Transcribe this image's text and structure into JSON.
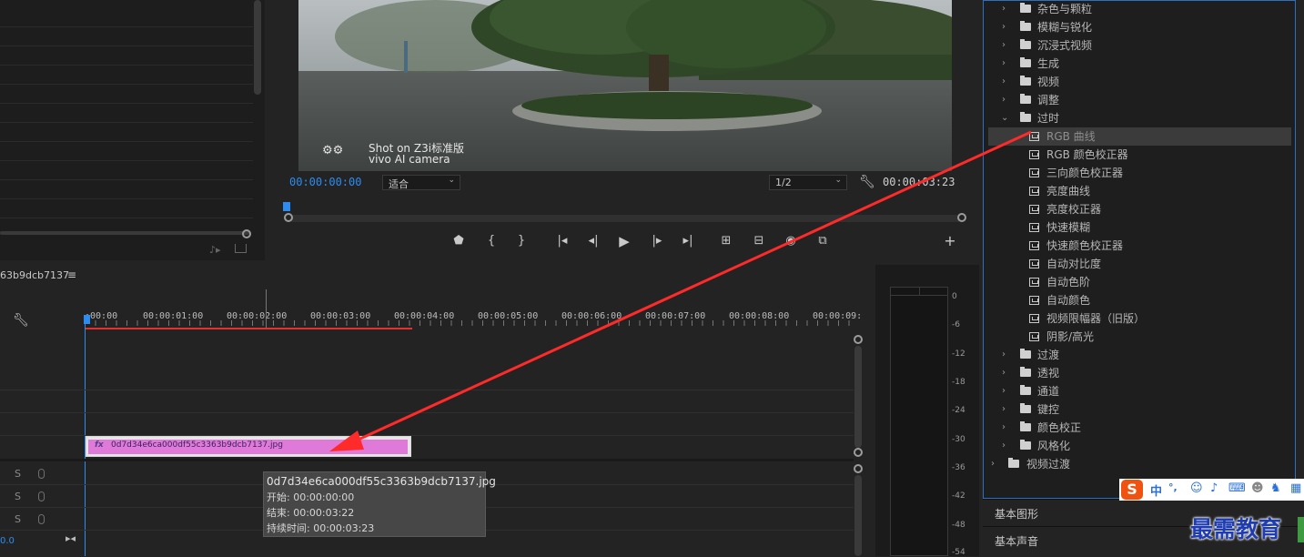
{
  "monitor": {
    "timecode_current": "00:00:00:00",
    "fit_label": "适合",
    "resolution_label": "1/2",
    "timecode_duration": "00:00:03:23",
    "watermark_line1": "Shot on Z3i标准版",
    "watermark_line2": "vivo AI camera"
  },
  "timeline": {
    "sequence_name": "63b9dcb7137",
    "menu_icon": "hamburger-icon",
    "ruler_labels": [
      ":00:00",
      "00:00:01:00",
      "00:00:02:00",
      "00:00:03:00",
      "00:00:04:00",
      "00:00:05:00",
      "00:00:06:00",
      "00:00:07:00",
      "00:00:08:00",
      "00:00:09:"
    ],
    "clip_name": "0d7d34e6ca000df55c3363b9dcb7137.jpg",
    "clip_fx_badge": "fx",
    "track_toggle": "S",
    "bottom_value": "0.0",
    "clip_color": "#e07ad8",
    "playhead_color": "#2d8cf0"
  },
  "tooltip": {
    "name": "0d7d34e6ca000df55c3363b9dcb7137.jpg",
    "start": "开始: 00:00:00:00",
    "end": "结束: 00:00:03:22",
    "duration": "持续时间: 00:00:03:23"
  },
  "meter": {
    "db_labels": [
      "0",
      "-6",
      "-12",
      "-18",
      "-24",
      "-30",
      "-36",
      "-42",
      "-48",
      "-54"
    ]
  },
  "effects": {
    "top_folders": [
      "杂色与颗粒",
      "模糊与锐化",
      "沉浸式视频",
      "生成",
      "视频",
      "调整"
    ],
    "open_folder": "过时",
    "open_items": [
      "RGB 曲线",
      "RGB 颜色校正器",
      "三向颜色校正器",
      "亮度曲线",
      "亮度校正器",
      "快速模糊",
      "快速颜色校正器",
      "自动对比度",
      "自动色阶",
      "自动颜色",
      "视频限幅器（旧版）",
      "阴影/高光"
    ],
    "selected_item": "RGB 曲线",
    "after_folders": [
      "过渡",
      "透视",
      "通道",
      "键控",
      "颜色校正",
      "风格化"
    ],
    "root_folder": "视频过渡"
  },
  "panels": {
    "essential_graphics": "基本图形",
    "essential_sound": "基本声音"
  },
  "ime": {
    "logo": "S",
    "lang": "中",
    "punct": "°,",
    "icons": [
      "smiley-icon",
      "microphone-icon",
      "keyboard-icon",
      "user-icon",
      "shirt-icon",
      "grid-icon"
    ]
  },
  "brand_watermark": "最需教育",
  "annotation": {
    "arrow_color": "#ff2a2a"
  }
}
